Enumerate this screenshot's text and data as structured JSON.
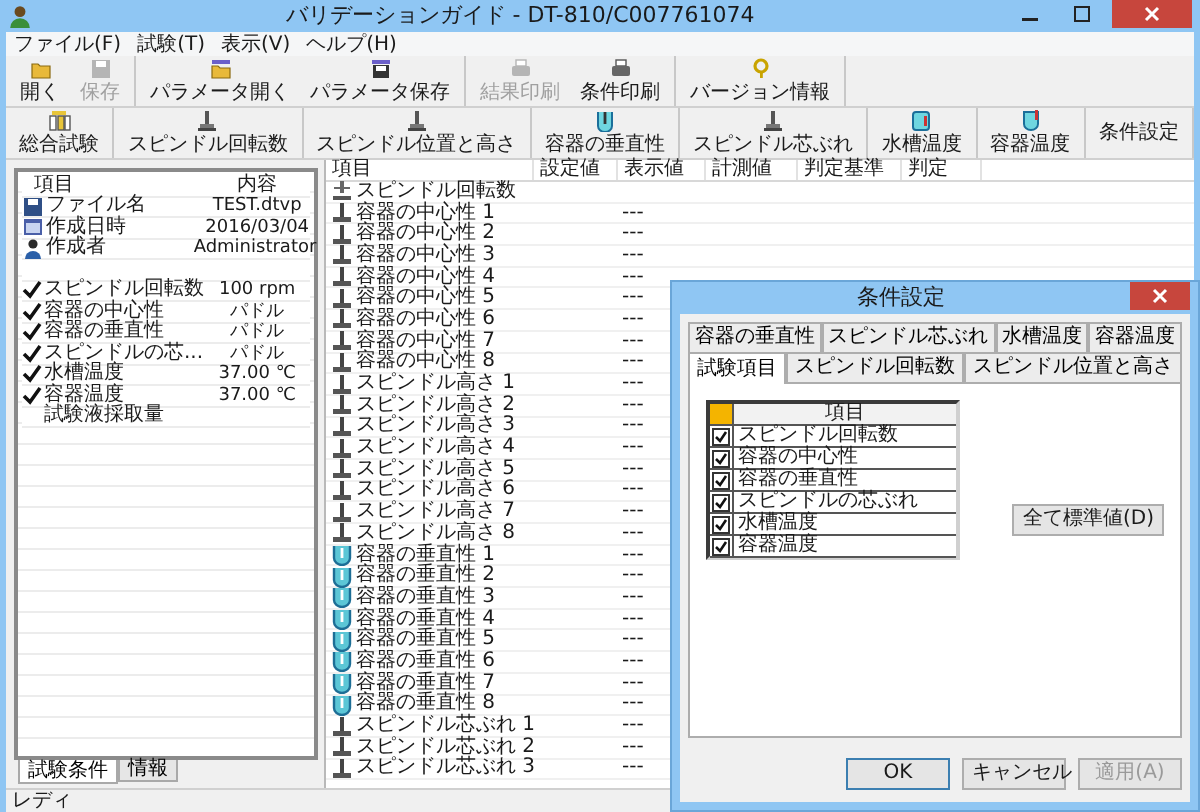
{
  "window": {
    "title": "バリデーションガイド - DT-810/C007761074"
  },
  "menu": [
    "ファイル(F)",
    "試験(T)",
    "表示(V)",
    "ヘルプ(H)"
  ],
  "toolbar": [
    [
      {
        "label": "開く",
        "kind": "open",
        "disabled": false
      },
      {
        "label": "保存",
        "kind": "save",
        "disabled": true
      }
    ],
    [
      {
        "label": "パラメータ開く",
        "kind": "paramopen",
        "disabled": false
      },
      {
        "label": "パラメータ保存",
        "kind": "paramsave",
        "disabled": false
      }
    ],
    [
      {
        "label": "結果印刷",
        "kind": "print",
        "disabled": true
      },
      {
        "label": "条件印刷",
        "kind": "print",
        "disabled": false
      }
    ],
    [
      {
        "label": "バージョン情報",
        "kind": "info",
        "disabled": false
      }
    ]
  ],
  "test_bar": [
    {
      "label": "総合試験",
      "kind": "all"
    },
    {
      "label": "スピンドル回転数",
      "kind": "rotation"
    },
    {
      "label": "スピンドル位置と高さ",
      "kind": "height"
    },
    {
      "label": "容器の垂直性",
      "kind": "vertical"
    },
    {
      "label": "スピンドル芯ぶれ",
      "kind": "wobble"
    },
    {
      "label": "水槽温度",
      "kind": "bath"
    },
    {
      "label": "容器温度",
      "kind": "vessel"
    },
    {
      "label": "条件設定",
      "kind": "plain"
    }
  ],
  "info_panel": {
    "columns": [
      "項目",
      "内容"
    ],
    "rows": [
      {
        "kind": "file",
        "item": "ファイル名",
        "value": "TEST.dtvp"
      },
      {
        "kind": "date",
        "item": "作成日時",
        "value": "2016/03/04"
      },
      {
        "kind": "author",
        "item": "作成者",
        "value": "Administrator"
      },
      {
        "kind": "blank"
      },
      {
        "kind": "check",
        "checked": true,
        "item": "スピンドル回転数",
        "value": "100 rpm"
      },
      {
        "kind": "check",
        "checked": true,
        "item": "容器の中心性",
        "value": "パドル"
      },
      {
        "kind": "check",
        "checked": true,
        "item": "容器の垂直性",
        "value": "パドル"
      },
      {
        "kind": "check",
        "checked": true,
        "item": "スピンドルの芯...",
        "value": "パドル"
      },
      {
        "kind": "check",
        "checked": true,
        "item": "水槽温度",
        "value": "37.00 ℃"
      },
      {
        "kind": "check",
        "checked": true,
        "item": "容器温度",
        "value": "37.00 ℃"
      },
      {
        "kind": "check",
        "checked": false,
        "item": "試験液採取量"
      }
    ],
    "tabs": [
      {
        "label": "試験条件",
        "selected": true
      },
      {
        "label": "情報",
        "selected": false
      }
    ]
  },
  "results": {
    "columns": [
      "項目",
      "設定値",
      "表示値",
      "計測値",
      "判定基準",
      "判定"
    ],
    "rows": [
      {
        "kind": "rotation",
        "item": "スピンドル回転数"
      },
      {
        "kind": "center",
        "item": "容器の中心性 1",
        "display": "---"
      },
      {
        "kind": "center",
        "item": "容器の中心性 2",
        "display": "---"
      },
      {
        "kind": "center",
        "item": "容器の中心性 3",
        "display": "---"
      },
      {
        "kind": "center",
        "item": "容器の中心性 4",
        "display": "---"
      },
      {
        "kind": "center",
        "item": "容器の中心性 5",
        "display": "---"
      },
      {
        "kind": "center",
        "item": "容器の中心性 6",
        "display": "---"
      },
      {
        "kind": "center",
        "item": "容器の中心性 7",
        "display": "---"
      },
      {
        "kind": "center",
        "item": "容器の中心性 8",
        "display": "---"
      },
      {
        "kind": "height",
        "item": "スピンドル高さ 1",
        "display": "---"
      },
      {
        "kind": "height",
        "item": "スピンドル高さ 2",
        "display": "---"
      },
      {
        "kind": "height",
        "item": "スピンドル高さ 3",
        "display": "---"
      },
      {
        "kind": "height",
        "item": "スピンドル高さ 4",
        "display": "---"
      },
      {
        "kind": "height",
        "item": "スピンドル高さ 5",
        "display": "---"
      },
      {
        "kind": "height",
        "item": "スピンドル高さ 6",
        "display": "---"
      },
      {
        "kind": "height",
        "item": "スピンドル高さ 7",
        "display": "---"
      },
      {
        "kind": "height",
        "item": "スピンドル高さ 8",
        "display": "---"
      },
      {
        "kind": "vertical",
        "item": "容器の垂直性 1",
        "display": "---"
      },
      {
        "kind": "vertical",
        "item": "容器の垂直性 2",
        "display": "---"
      },
      {
        "kind": "vertical",
        "item": "容器の垂直性 3",
        "display": "---"
      },
      {
        "kind": "vertical",
        "item": "容器の垂直性 4",
        "display": "---"
      },
      {
        "kind": "vertical",
        "item": "容器の垂直性 5",
        "display": "---"
      },
      {
        "kind": "vertical",
        "item": "容器の垂直性 6",
        "display": "---"
      },
      {
        "kind": "vertical",
        "item": "容器の垂直性 7",
        "display": "---"
      },
      {
        "kind": "vertical",
        "item": "容器の垂直性 8",
        "display": "---"
      },
      {
        "kind": "wobble",
        "item": "スピンドル芯ぶれ 1",
        "display": "---"
      },
      {
        "kind": "wobble",
        "item": "スピンドル芯ぶれ 2",
        "display": "---"
      },
      {
        "kind": "wobble",
        "item": "スピンドル芯ぶれ 3",
        "display": "---"
      }
    ]
  },
  "status_bar": "レディ",
  "dialog": {
    "title": "条件設定",
    "tab_rows": [
      [
        {
          "label": "容器の垂直性",
          "selected": false
        },
        {
          "label": "スピンドル芯ぶれ",
          "selected": false
        },
        {
          "label": "水槽温度",
          "selected": false
        },
        {
          "label": "容器温度",
          "selected": false
        }
      ],
      [
        {
          "label": "試験項目",
          "selected": true
        },
        {
          "label": "スピンドル回転数",
          "selected": false
        },
        {
          "label": "スピンドル位置と高さ",
          "selected": false
        }
      ]
    ],
    "grid_header": "項目",
    "items": [
      {
        "label": "スピンドル回転数",
        "checked": true
      },
      {
        "label": "容器の中心性",
        "checked": true
      },
      {
        "label": "容器の垂直性",
        "checked": true
      },
      {
        "label": "スピンドルの芯ぶれ",
        "checked": true
      },
      {
        "label": "水槽温度",
        "checked": true
      },
      {
        "label": "容器温度",
        "checked": true
      }
    ],
    "reset_button": "全て標準値(D)",
    "buttons": [
      {
        "label": "OK",
        "disabled": false
      },
      {
        "label": "キャンセル",
        "disabled": false
      },
      {
        "label": "適用(A)",
        "disabled": true
      }
    ]
  }
}
